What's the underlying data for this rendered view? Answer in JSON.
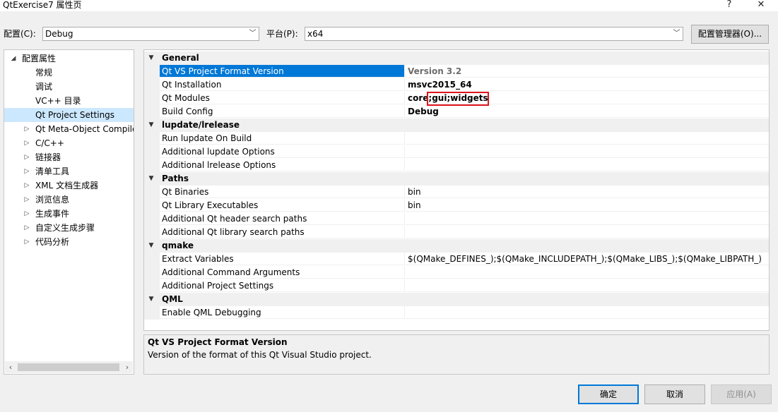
{
  "window": {
    "title": "QtExercise7 属性页",
    "help_label": "?",
    "close_label": "✕"
  },
  "config": {
    "label": "配置(C):",
    "value": "Debug",
    "platform_label": "平台(P):",
    "platform_value": "x64",
    "manager_button": "配置管理器(O)..."
  },
  "tree": {
    "root": "配置属性",
    "children": [
      {
        "label": "常规"
      },
      {
        "label": "调试"
      },
      {
        "label": "VC++ 目录"
      },
      {
        "label": "Qt Project Settings"
      },
      {
        "label": "Qt Meta-Object Compile"
      },
      {
        "label": "C/C++"
      },
      {
        "label": "链接器"
      },
      {
        "label": "清单工具"
      },
      {
        "label": "XML 文档生成器"
      },
      {
        "label": "浏览信息"
      },
      {
        "label": "生成事件"
      },
      {
        "label": "自定义生成步骤"
      },
      {
        "label": "代码分析"
      }
    ],
    "selected": "Qt Project Settings"
  },
  "grid": {
    "categories": [
      {
        "name": "General",
        "items": [
          {
            "name": "Qt VS Project Format Version",
            "value": "Version 3.2"
          },
          {
            "name": "Qt Installation",
            "value": "msvc2015_64"
          },
          {
            "name": "Qt Modules",
            "value": "core;gui;widgets"
          },
          {
            "name": "Build Config",
            "value": "Debug"
          }
        ]
      },
      {
        "name": "lupdate/lrelease",
        "items": [
          {
            "name": "Run lupdate On Build",
            "value": ""
          },
          {
            "name": "Additional lupdate Options",
            "value": ""
          },
          {
            "name": "Additional lrelease Options",
            "value": ""
          }
        ]
      },
      {
        "name": "Paths",
        "items": [
          {
            "name": "Qt Binaries",
            "value": "bin"
          },
          {
            "name": "Qt Library Executables",
            "value": "bin"
          },
          {
            "name": "Additional Qt header search paths",
            "value": ""
          },
          {
            "name": "Additional Qt library search paths",
            "value": ""
          }
        ]
      },
      {
        "name": "qmake",
        "items": [
          {
            "name": "Extract Variables",
            "value": "$(QMake_DEFINES_);$(QMake_INCLUDEPATH_);$(QMake_LIBS_);$(QMake_LIBPATH_)"
          },
          {
            "name": "Additional Command Arguments",
            "value": ""
          },
          {
            "name": "Additional Project Settings",
            "value": ""
          }
        ]
      },
      {
        "name": "QML",
        "items": [
          {
            "name": "Enable QML Debugging",
            "value": ""
          }
        ]
      }
    ],
    "selected_property": "Qt VS Project Format Version"
  },
  "description": {
    "title": "Qt VS Project Format Version",
    "text": "Version of the format of this Qt Visual Studio project."
  },
  "buttons": {
    "ok": "确定",
    "cancel": "取消",
    "apply": "应用(A)"
  }
}
